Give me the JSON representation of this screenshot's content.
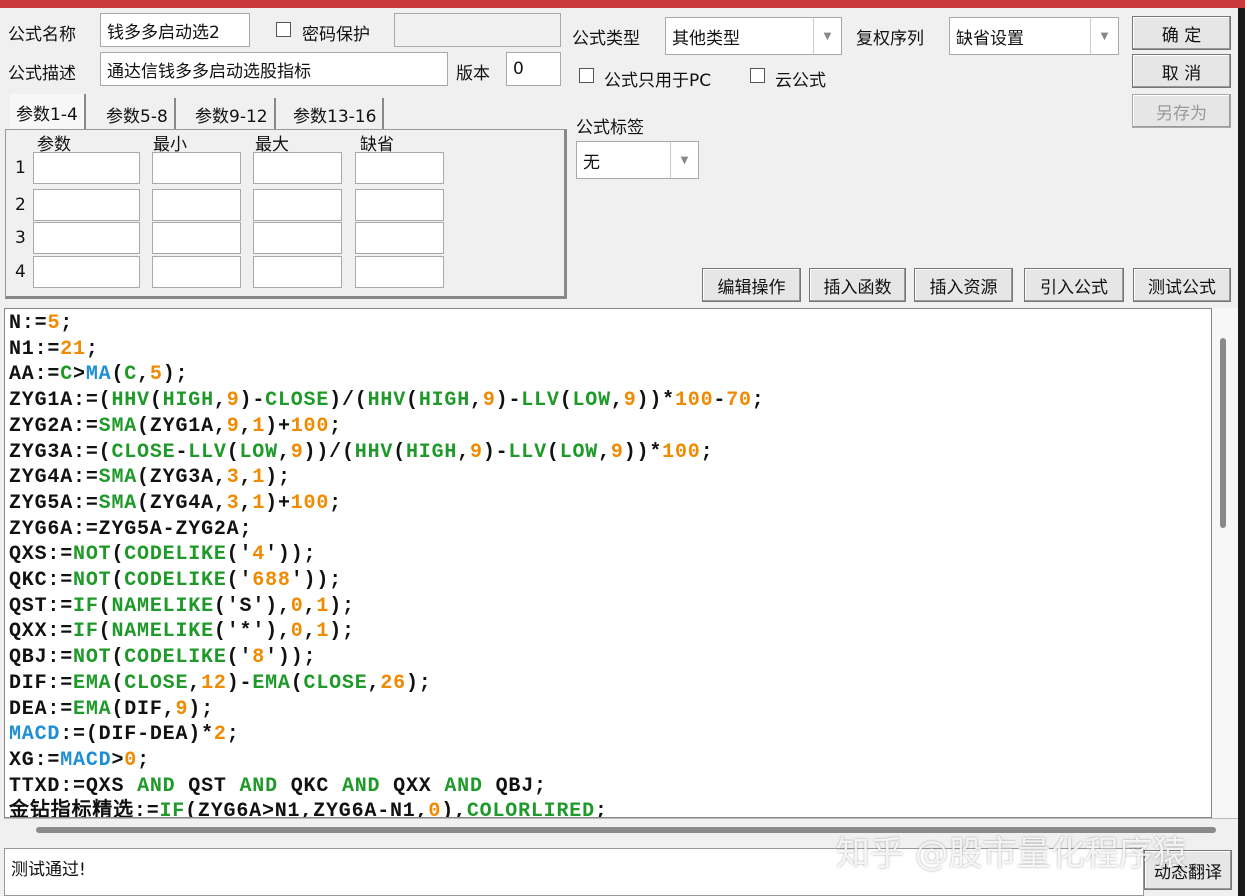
{
  "header": {
    "name_label": "公式名称",
    "name_value": "钱多多启动选2",
    "password_label": "密码保护",
    "password_value": "",
    "desc_label": "公式描述",
    "desc_value": "通达信钱多多启动选股指标",
    "version_label": "版本",
    "version_value": "0",
    "type_label": "公式类型",
    "type_value": "其他类型",
    "rights_label": "复权序列",
    "rights_value": "缺省设置",
    "pc_only_label": "公式只用于PC",
    "cloud_label": "云公式",
    "tag_label": "公式标签",
    "tag_value": "无"
  },
  "buttons": {
    "ok": "确 定",
    "cancel": "取 消",
    "save_as": "另存为",
    "edit_ops": "编辑操作",
    "insert_func": "插入函数",
    "insert_res": "插入资源",
    "import_formula": "引入公式",
    "test_formula": "测试公式",
    "dynamic_translate": "动态翻译"
  },
  "params": {
    "tabs": [
      "参数1-4",
      "参数5-8",
      "参数9-12",
      "参数13-16"
    ],
    "columns": [
      "参数",
      "最小",
      "最大",
      "缺省"
    ],
    "rows": [
      "1",
      "2",
      "3",
      "4"
    ]
  },
  "code_lines": [
    "N:=5;",
    "N1:=21;",
    "AA:=C>MA(C,5);",
    "ZYG1A:=(HHV(HIGH,9)-CLOSE)/(HHV(HIGH,9)-LLV(LOW,9))*100-70;",
    "ZYG2A:=SMA(ZYG1A,9,1)+100;",
    "ZYG3A:=(CLOSE-LLV(LOW,9))/(HHV(HIGH,9)-LLV(LOW,9))*100;",
    "ZYG4A:=SMA(ZYG3A,3,1);",
    "ZYG5A:=SMA(ZYG4A,3,1)+100;",
    "ZYG6A:=ZYG5A-ZYG2A;",
    "QXS:=NOT(CODELIKE('4'));",
    "QKC:=NOT(CODELIKE('688'));",
    "QST:=IF(NAMELIKE('S'),0,1);",
    "QXX:=IF(NAMELIKE('*'),0,1);",
    "QBJ:=NOT(CODELIKE('8'));",
    "DIF:=EMA(CLOSE,12)-EMA(CLOSE,26);",
    "DEA:=EMA(DIF,9);",
    "MACD:=(DIF-DEA)*2;",
    "XG:=MACD>0;",
    "TTXD:=QXS AND QST AND QKC AND QXX AND QBJ;",
    "金钻指标精选:=IF(ZYG6A>N1,ZYG6A-N1,0),COLORLIRED;"
  ],
  "status_text": "测试通过!",
  "watermark": "知乎 @股市量化程序猿",
  "colors": {
    "number": "#f08a00",
    "function": "#1f9a2a",
    "variable": "#1e8fd4",
    "title_bar": "#c9393e"
  }
}
